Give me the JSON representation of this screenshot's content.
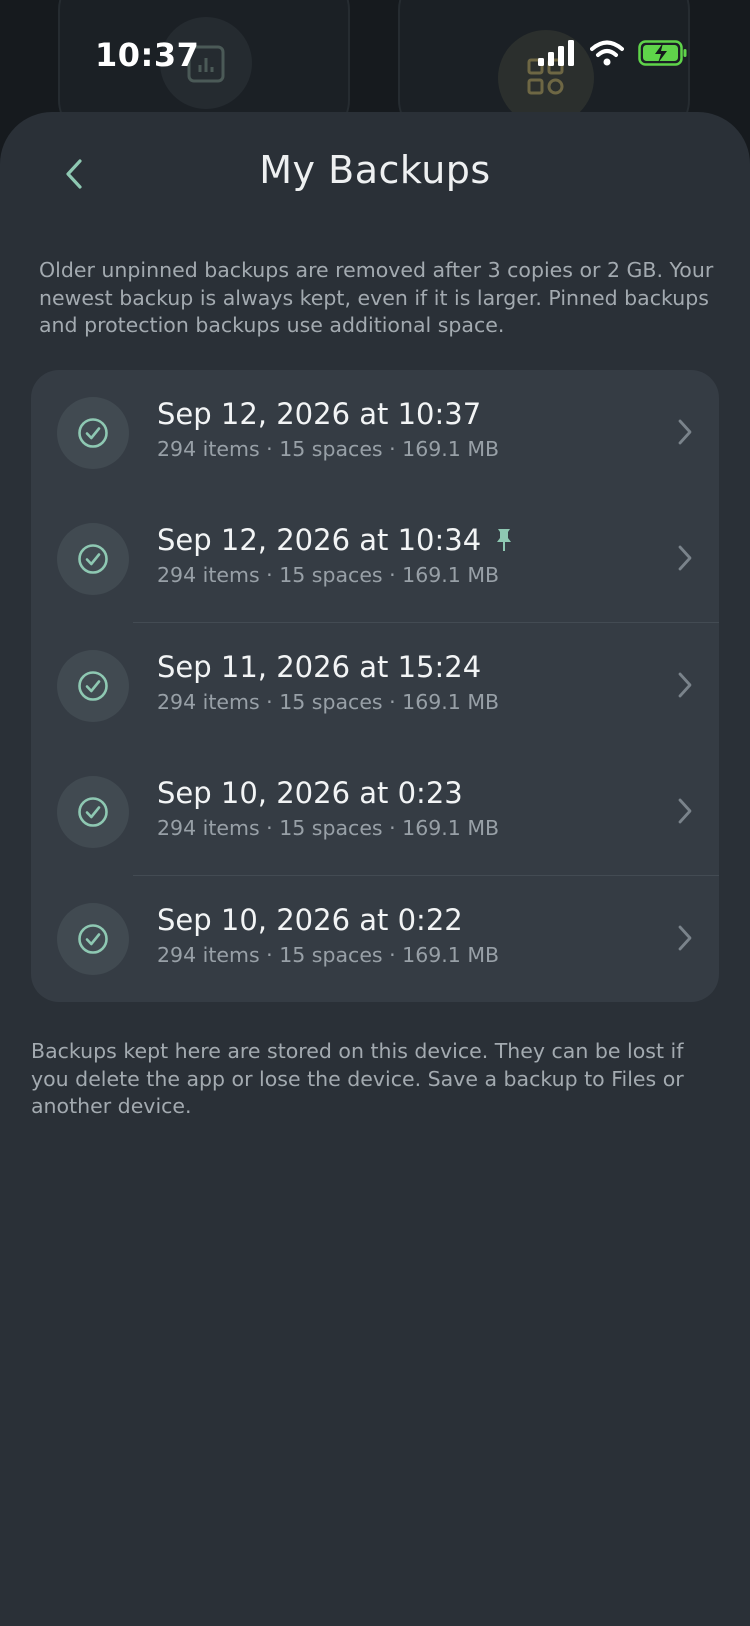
{
  "status_bar": {
    "time": "10:37",
    "icons": [
      "signal-icon",
      "wifi-icon",
      "battery-charging-icon"
    ]
  },
  "header": {
    "title": "My Backups",
    "back_icon": "chevron-left-icon"
  },
  "intro_text": "Older unpinned backups are removed after 3 copies or 2 GB. Your newest backup is always kept, even if it is larger. Pinned backups and protection backups use additional space.",
  "backups": [
    {
      "title": "Sep 12, 2026 at 10:37",
      "meta": "294 items · 15 spaces · 169.1 MB",
      "pinned": false
    },
    {
      "title": "Sep 12, 2026 at 10:34",
      "meta": "294 items · 15 spaces · 169.1 MB",
      "pinned": true
    },
    {
      "title": "Sep 11, 2026 at 15:24",
      "meta": "294 items · 15 spaces · 169.1 MB",
      "pinned": false
    },
    {
      "title": "Sep 10, 2026 at 0:23",
      "meta": "294 items · 15 spaces · 169.1 MB",
      "pinned": false
    },
    {
      "title": "Sep 10, 2026 at 0:22",
      "meta": "294 items · 15 spaces · 169.1 MB",
      "pinned": false
    }
  ],
  "footer_text": "Backups kept here are stored on this device. They can be lost if you delete the app or lose the device. Save a backup to Files or another device.",
  "colors": {
    "accent": "#8ec8b2",
    "sheet_bg": "#2a3037",
    "list_bg": "#353c44",
    "battery": "#5fd44a"
  }
}
